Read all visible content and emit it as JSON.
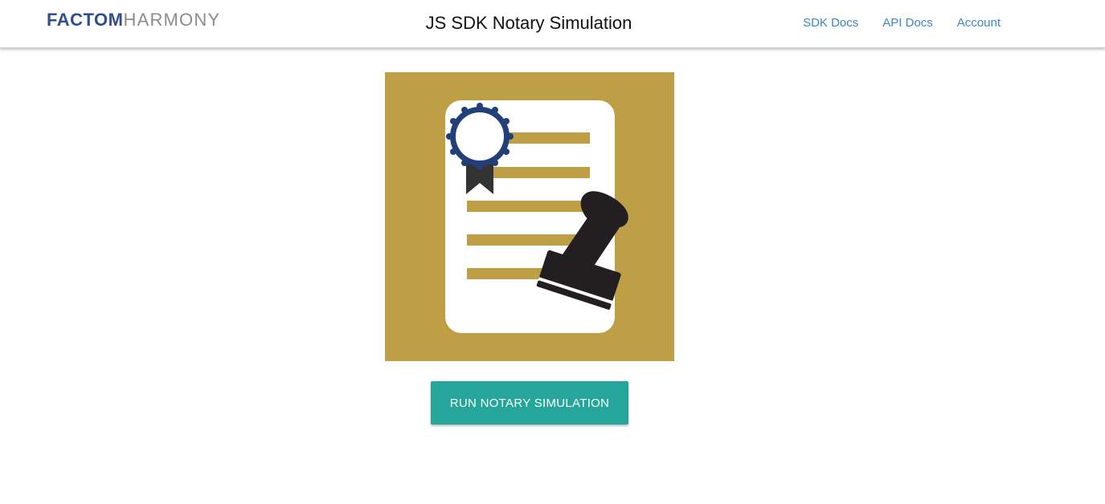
{
  "header": {
    "logo_primary": "FACTOM",
    "logo_secondary": "HARMONY",
    "title": "JS SDK Notary Simulation",
    "nav": [
      {
        "label": "SDK Docs"
      },
      {
        "label": "API Docs"
      },
      {
        "label": "Account"
      }
    ]
  },
  "hero": {
    "icon": "notarized-document-icon",
    "colors": {
      "background": "#bf9f45",
      "paper": "#ffffff",
      "seal_ring": "#233f7a",
      "stamp": "#231f20"
    }
  },
  "actions": {
    "run_label": "RUN NOTARY SIMULATION",
    "accent": "#26a69a"
  }
}
